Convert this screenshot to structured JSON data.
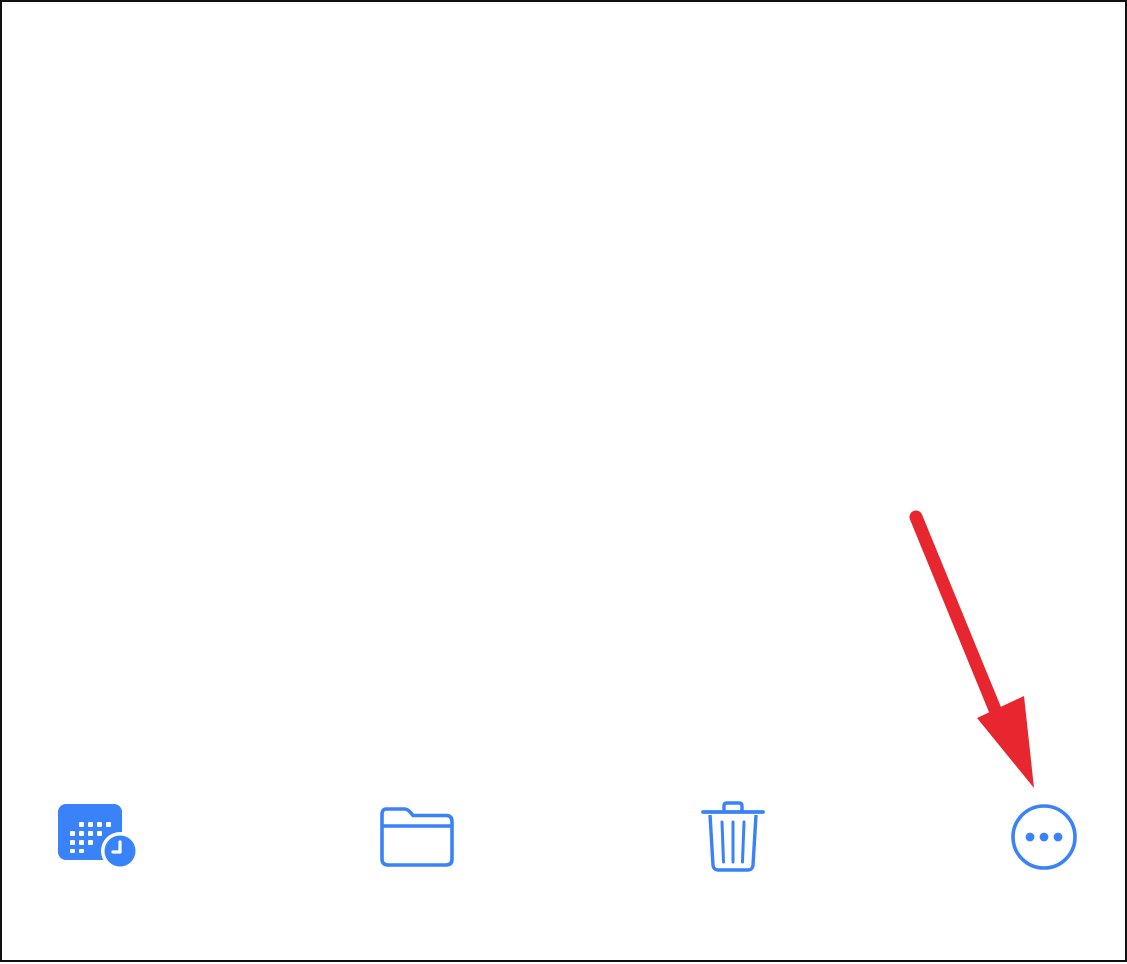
{
  "accent_color": "#3a82f7",
  "annotation_color": "#e8262f",
  "toolbar": {
    "items": [
      {
        "name": "schedule-send",
        "icon": "calendar-clock-icon"
      },
      {
        "name": "move-to-folder",
        "icon": "folder-icon"
      },
      {
        "name": "delete",
        "icon": "trash-icon"
      },
      {
        "name": "more-options",
        "icon": "ellipsis-circle-icon"
      }
    ]
  },
  "annotation": {
    "type": "arrow",
    "points_to": "more-options"
  }
}
